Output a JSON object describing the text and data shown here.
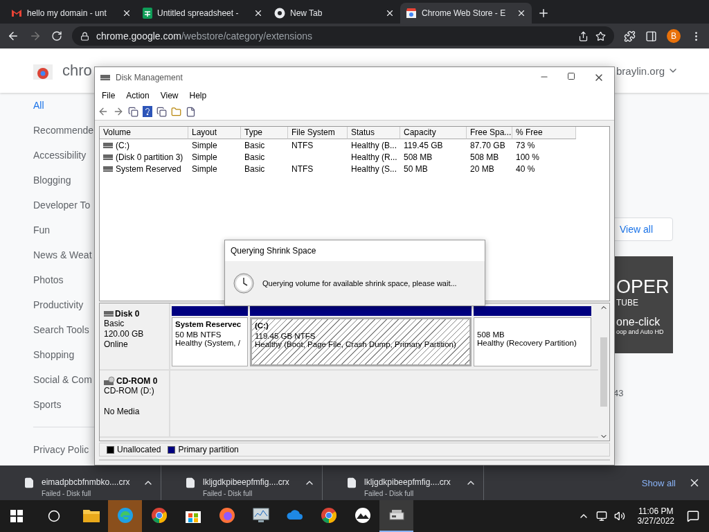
{
  "browser": {
    "tabs": [
      {
        "title": "hello my domain - unt",
        "kind": "mail",
        "selected": false
      },
      {
        "title": "Untitled spreadsheet -",
        "kind": "sheet",
        "selected": false
      },
      {
        "title": "New Tab",
        "kind": "chrome",
        "selected": false
      },
      {
        "title": "Chrome Web Store - E",
        "kind": "store",
        "selected": true
      }
    ],
    "url": {
      "host": "chrome.google.com",
      "path": "/webstore/category/extensions"
    },
    "avatar": "B"
  },
  "store": {
    "logo_text": "chro",
    "account": "braylin.org",
    "categories": [
      {
        "label": "All",
        "selected": true
      },
      {
        "label": "Recommende",
        "selected": false
      },
      {
        "label": "Accessibility",
        "selected": false
      },
      {
        "label": "Blogging",
        "selected": false
      },
      {
        "label": "Developer To",
        "selected": false
      },
      {
        "label": "Fun",
        "selected": false
      },
      {
        "label": "News & Weat",
        "selected": false
      },
      {
        "label": "Photos",
        "selected": false
      },
      {
        "label": "Productivity",
        "selected": false
      },
      {
        "label": "Search Tools",
        "selected": false
      },
      {
        "label": "Shopping",
        "selected": false
      },
      {
        "label": "Social & Com",
        "selected": false
      },
      {
        "label": "Sports",
        "selected": false
      }
    ],
    "footer_links": [
      "Privacy Polic"
    ],
    "view_all": "View all",
    "banner": {
      "title": "OPER",
      "subtitle": "TUBE",
      "tagline": "one-click",
      "caption": "oop and Auto HD"
    },
    "side_text": "43"
  },
  "downloads": {
    "items": [
      {
        "name": "eimadpbcbfnmbko....crx",
        "status": "Failed - Disk full"
      },
      {
        "name": "lkljgdkpibeepfmfig....crx",
        "status": "Failed - Disk full"
      },
      {
        "name": "lkljgdkpibeepfmfig....crx",
        "status": "Failed - Disk full"
      }
    ],
    "show_all": "Show all"
  },
  "disk_management": {
    "title": "Disk Management",
    "menu": [
      "File",
      "Action",
      "View",
      "Help"
    ],
    "columns": [
      "Volume",
      "Layout",
      "Type",
      "File System",
      "Status",
      "Capacity",
      "Free Spa...",
      "% Free"
    ],
    "volumes": [
      {
        "volume": "(C:)",
        "layout": "Simple",
        "type": "Basic",
        "file_system": "NTFS",
        "status": "Healthy (B...",
        "capacity": "119.45 GB",
        "free_space": "87.70 GB",
        "percent_free": "73 %"
      },
      {
        "volume": "(Disk 0 partition 3)",
        "layout": "Simple",
        "type": "Basic",
        "status": "Healthy (R...",
        "capacity": "508 MB",
        "free_space": "508 MB",
        "percent_free": "100 %"
      },
      {
        "volume": "System Reserved",
        "layout": "Simple",
        "type": "Basic",
        "file_system": "NTFS",
        "status": "Healthy (S...",
        "capacity": "50 MB",
        "free_space": "20 MB",
        "percent_free": "40 %"
      }
    ],
    "disks": [
      {
        "kind": "disk",
        "name": "Disk 0",
        "lines": [
          "Basic",
          "120.00 GB",
          "Online"
        ],
        "partitions": [
          {
            "name": "System Reservec",
            "lines": [
              "50 MB NTFS",
              "Healthy (System, /"
            ],
            "selected": false
          },
          {
            "name": "(C:)",
            "lines": [
              "119.45 GB NTFS",
              "Healthy (Boot, Page File, Crash Dump, Primary Partition)"
            ],
            "selected": true
          },
          {
            "lines": [
              "508 MB",
              "Healthy (Recovery Partition)"
            ],
            "selected": false
          }
        ]
      },
      {
        "kind": "cdrom",
        "name": "CD-ROM 0",
        "lines": [
          "CD-ROM (D:)"
        ],
        "note": "No Media"
      }
    ],
    "legend": [
      {
        "label": "Unallocated",
        "color": "#000000"
      },
      {
        "label": "Primary partition",
        "color": "#000080"
      }
    ]
  },
  "dialog": {
    "title": "Querying Shrink Space",
    "message": "Querying volume for available shrink space, please wait..."
  },
  "taskbar": {
    "apps": [
      {
        "kind": "explorer",
        "flashing": false,
        "open": false
      },
      {
        "kind": "edge",
        "flashing": true,
        "open": false
      },
      {
        "kind": "chrome",
        "flashing": false,
        "open": false
      },
      {
        "kind": "store",
        "flashing": false,
        "open": false
      },
      {
        "kind": "firefox",
        "flashing": false,
        "open": false
      },
      {
        "kind": "monitor",
        "flashing": false,
        "open": false
      },
      {
        "kind": "cloud",
        "flashing": false,
        "open": false
      },
      {
        "kind": "chrome",
        "flashing": false,
        "open": false
      },
      {
        "kind": "photos",
        "flashing": false,
        "open": false
      },
      {
        "kind": "disk",
        "flashing": false,
        "open": true
      }
    ],
    "time": "11:06 PM",
    "date": "3/27/2022"
  }
}
